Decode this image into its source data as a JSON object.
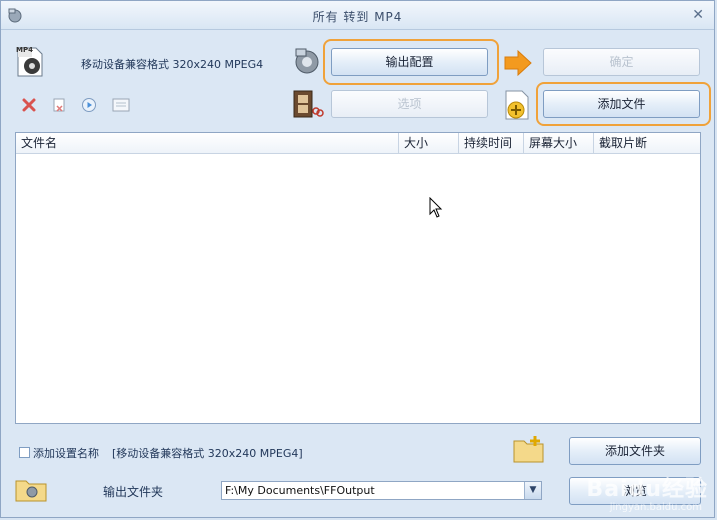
{
  "window": {
    "title": "所有 转到 MP4",
    "close_symbol": "✕"
  },
  "profile": {
    "icon_text": "MP4",
    "format_label": "移动设备兼容格式 320x240 MPEG4"
  },
  "toolbar": {
    "output_config_label": "输出配置",
    "ok_label": "确定",
    "options_label": "选项",
    "add_file_label": "添加文件"
  },
  "file_table": {
    "columns": [
      "文件名",
      "大小",
      "持续时间",
      "屏幕大小",
      "截取片断"
    ],
    "rows": []
  },
  "footer": {
    "add_settings_name_label": "添加设置名称",
    "add_settings_name_value": "[移动设备兼容格式 320x240 MPEG4]",
    "add_folder_label": "添加文件夹",
    "output_folder_label": "输出文件夹",
    "output_folder_value": "F:\\My Documents\\FFOutput",
    "browse_label": "浏览"
  },
  "watermark": {
    "main": "Baidu经验",
    "sub": "jingyan.baidu.com"
  },
  "colors": {
    "highlight": "#f0a23a",
    "window_bg": "#dbe7f4"
  }
}
